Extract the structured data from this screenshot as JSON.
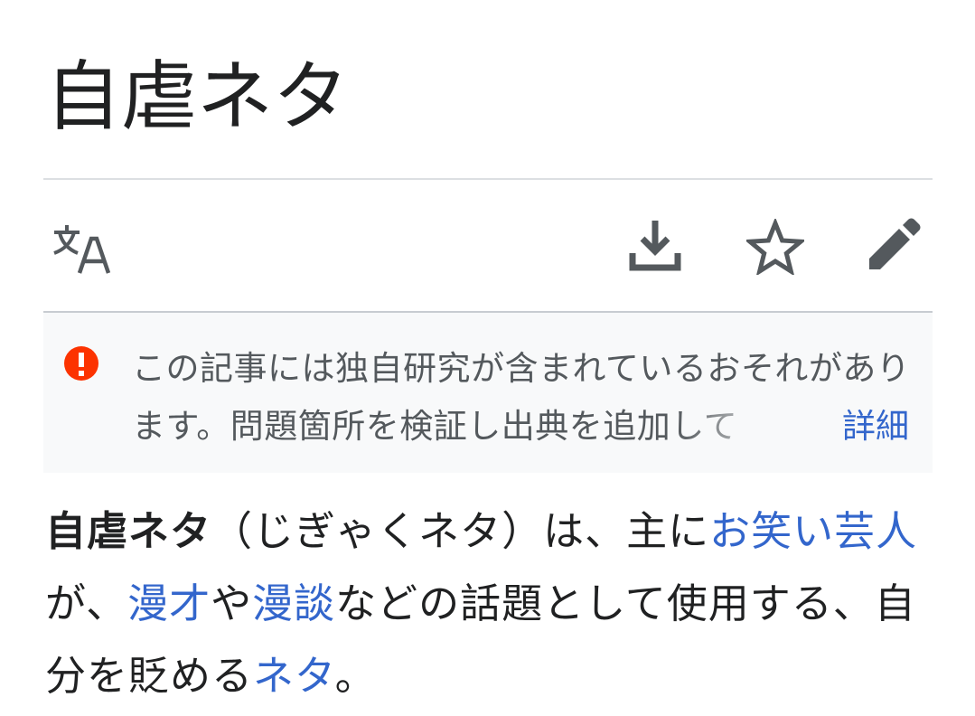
{
  "page": {
    "title": "自虐ネタ"
  },
  "toolbar": {
    "language_icon": "language-icon",
    "download_icon": "download-icon",
    "watch_icon": "star-icon",
    "edit_icon": "pencil-icon"
  },
  "notice": {
    "icon": "exclamation-icon",
    "text": "この記事には独自研究が含まれているおそれがあります。問題箇所を検証し出典を追加して",
    "link_label": "詳細",
    "icon_color": "#fc3300"
  },
  "lead": {
    "term": "自虐ネタ",
    "reading": "（じぎゃくネタ）は、主に",
    "link_owarai": "お笑い芸人",
    "text_ga": "が、",
    "link_manzai": "漫才",
    "text_ya": "や",
    "link_mandan": "漫談",
    "text_middle": "などの話題として使用する、自分を貶める",
    "link_neta": "ネタ",
    "text_end": "。"
  },
  "colors": {
    "link": "#3366cc",
    "text": "#202122",
    "notice_background": "#f8f9fa",
    "divider": "#dcdfe2"
  }
}
